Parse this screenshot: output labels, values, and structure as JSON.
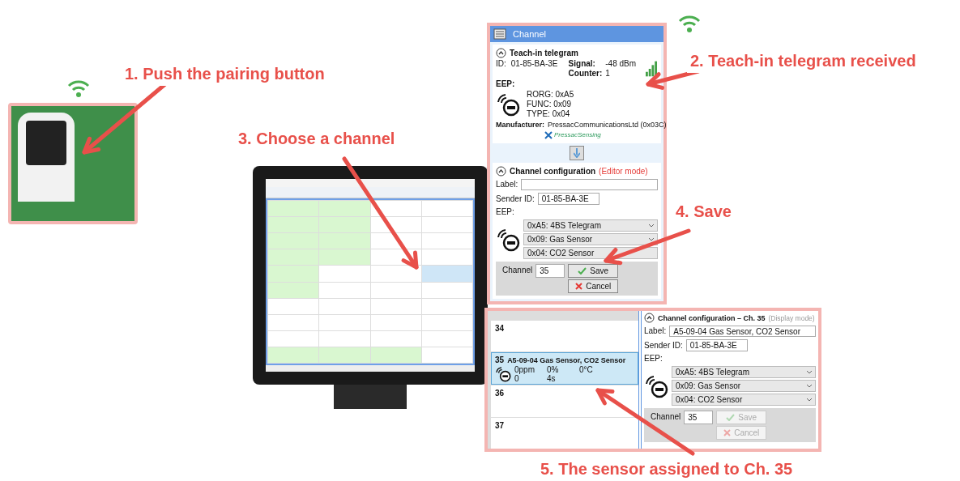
{
  "steps": [
    {
      "text": "1. Push the pairing button"
    },
    {
      "text": "2. Teach-in telegram received"
    },
    {
      "text": "3. Choose a channel"
    },
    {
      "text": "4. Save"
    },
    {
      "text": "5. The sensor assigned to Ch. 35"
    }
  ],
  "channel_window": {
    "title": "Channel",
    "teach_in": {
      "heading": "Teach-in telegram",
      "id_label": "ID:",
      "id": "01-85-BA-3E",
      "signal_label": "Signal:",
      "signal": "-48 dBm",
      "counter_label": "Counter:",
      "counter": "1",
      "eep_label": "EEP:",
      "eep_lines": [
        "RORG: 0xA5",
        "FUNC: 0x09",
        "TYPE: 0x04"
      ],
      "manufacturer_label": "Manufacturer:",
      "manufacturer": "PressacCommunicationsLtd (0x03C)",
      "logo": "PressacSensing"
    },
    "config": {
      "heading": "Channel configuration",
      "mode": "(Editor mode)",
      "label_label": "Label:",
      "sender_label": "Sender ID:",
      "sender": "01-85-BA-3E",
      "eep_label": "EEP:",
      "selects": [
        {
          "value": "0xA5: 4BS Telegram",
          "dropdown": true
        },
        {
          "value": "0x09: Gas Sensor",
          "dropdown": true
        },
        {
          "value": "0x04: CO2 Sensor",
          "dropdown": false
        }
      ],
      "channel_label": "Channel",
      "channel": "35",
      "buttons": [
        {
          "kind": "save",
          "label": "Save",
          "disabled": false
        },
        {
          "kind": "cancel",
          "label": "Cancel",
          "disabled": false
        }
      ]
    }
  },
  "result_panel": {
    "channels": [
      {
        "number": "34",
        "selected": false
      },
      {
        "number": "35",
        "title": "A5-09-04 Gas Sensor, CO2 Sensor",
        "values": [
          "0ppm",
          "0%",
          "0°C",
          "0",
          "4s"
        ],
        "selected": true
      },
      {
        "number": "36",
        "selected": false
      },
      {
        "number": "37",
        "selected": false
      }
    ],
    "config": {
      "heading": "Channel configuration – Ch. 35",
      "mode": "(Display mode)",
      "label_label": "Label:",
      "label_value": "A5-09-04 Gas Sensor, CO2 Sensor",
      "sender_label": "Sender ID:",
      "sender": "01-85-BA-3E",
      "eep_label": "EEP:",
      "selects": [
        {
          "value": "0xA5: 4BS Telegram",
          "dropdown": true
        },
        {
          "value": "0x09: Gas Sensor",
          "dropdown": true
        },
        {
          "value": "0x04: CO2 Sensor",
          "dropdown": true
        }
      ],
      "channel_label": "Channel",
      "channel": "35",
      "buttons": [
        {
          "kind": "save",
          "label": "Save",
          "disabled": true
        },
        {
          "kind": "cancel",
          "label": "Cancel",
          "disabled": true
        }
      ]
    }
  }
}
